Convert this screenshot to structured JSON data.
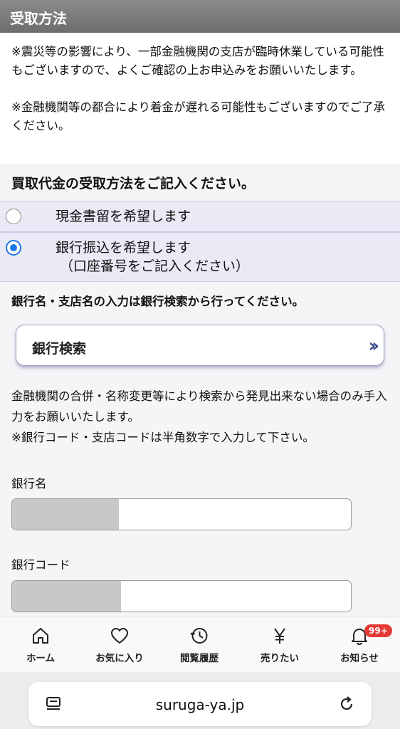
{
  "section": {
    "title": "受取方法"
  },
  "notice": {
    "line1": "※震災等の影響により、一部金融機関の支店が臨時休業している可能性もございますので、よくご確認の上お申込みをお願いいたします。",
    "line2": "※金融機関等の都合により着金が遅れる可能性もございますのでご了承ください。"
  },
  "payout": {
    "question": "買取代金の受取方法をご記入ください。",
    "options": [
      {
        "label": "現金書留を希望します",
        "selected": false
      },
      {
        "label": "銀行振込を希望します",
        "sub": "（口座番号をご記入ください）",
        "selected": true
      }
    ]
  },
  "bank": {
    "instruction": "銀行名・支店名の入力は銀行検索から行ってください。",
    "search_button": "銀行検索",
    "note1": "金融機関の合併・名称変更等により検索から発見出来ない場合のみ手入力をお願いいたします。",
    "note2": "※銀行コード・支店コードは半角数字で入力して下さい。",
    "fields": [
      {
        "label": "銀行名",
        "value": ""
      },
      {
        "label": "銀行コード",
        "value": ""
      }
    ]
  },
  "tabbar": {
    "items": [
      {
        "label": "ホーム",
        "icon": "home-icon"
      },
      {
        "label": "お気に入り",
        "icon": "heart-icon"
      },
      {
        "label": "閲覧履歴",
        "icon": "history-icon"
      },
      {
        "label": "売りたい",
        "icon": "yen-icon"
      },
      {
        "label": "お知らせ",
        "icon": "bell-icon",
        "badge": "99+"
      }
    ],
    "badge_color": "#e53935"
  },
  "browser": {
    "url": "suruga-ya.jp"
  },
  "colors": {
    "accent": "#1e76e8",
    "option_bg": "#eaeaf7",
    "chevron": "#3b4a8f"
  }
}
